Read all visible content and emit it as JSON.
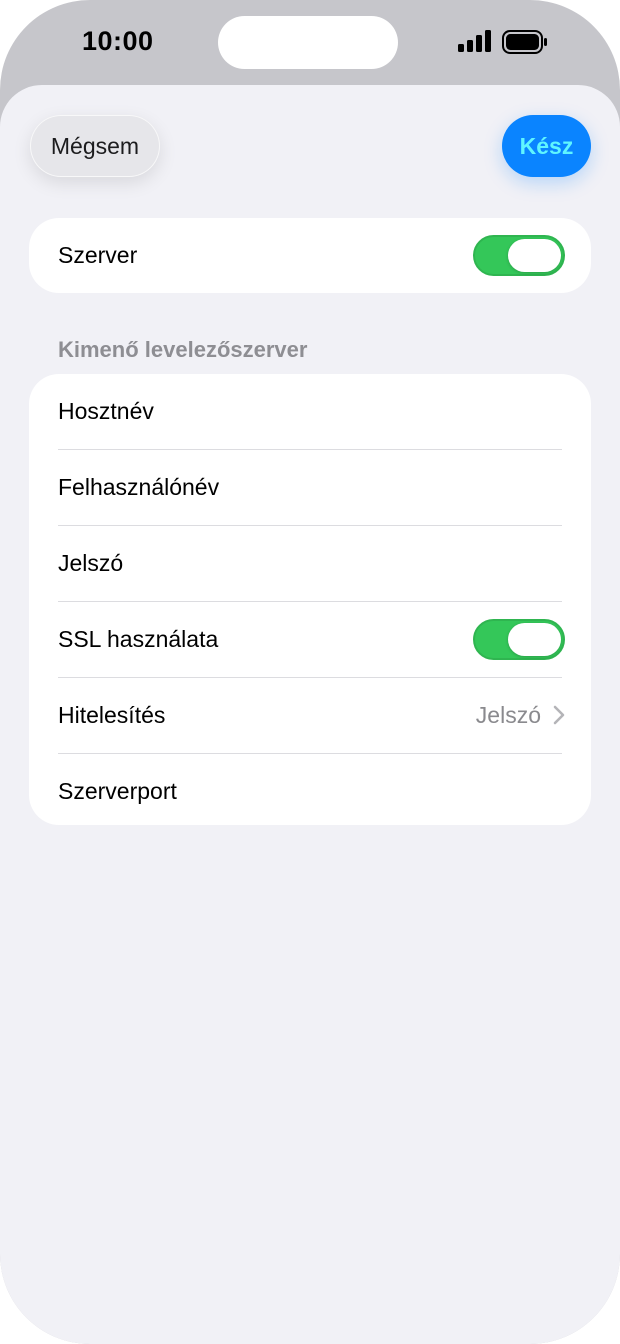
{
  "status_bar": {
    "time": "10:00",
    "icons": [
      "signal-bars-icon",
      "battery-icon"
    ]
  },
  "nav": {
    "cancel_label": "Mégsem",
    "done_label": "Kész"
  },
  "server": {
    "label": "Szerver",
    "enabled": true
  },
  "outgoing": {
    "header": "Kimenő levelezőszerver",
    "rows": [
      {
        "label": "Hosztnév"
      },
      {
        "label": "Felhasználónév"
      },
      {
        "label": "Jelszó"
      },
      {
        "label": "SSL használata",
        "toggle": true
      },
      {
        "label": "Hitelesítés",
        "value": "Jelszó"
      },
      {
        "label": "Szerverport"
      }
    ]
  },
  "colors": {
    "accent": "#0a84ff",
    "toggle_on": "#34c759",
    "background": "#f1f1f6"
  }
}
